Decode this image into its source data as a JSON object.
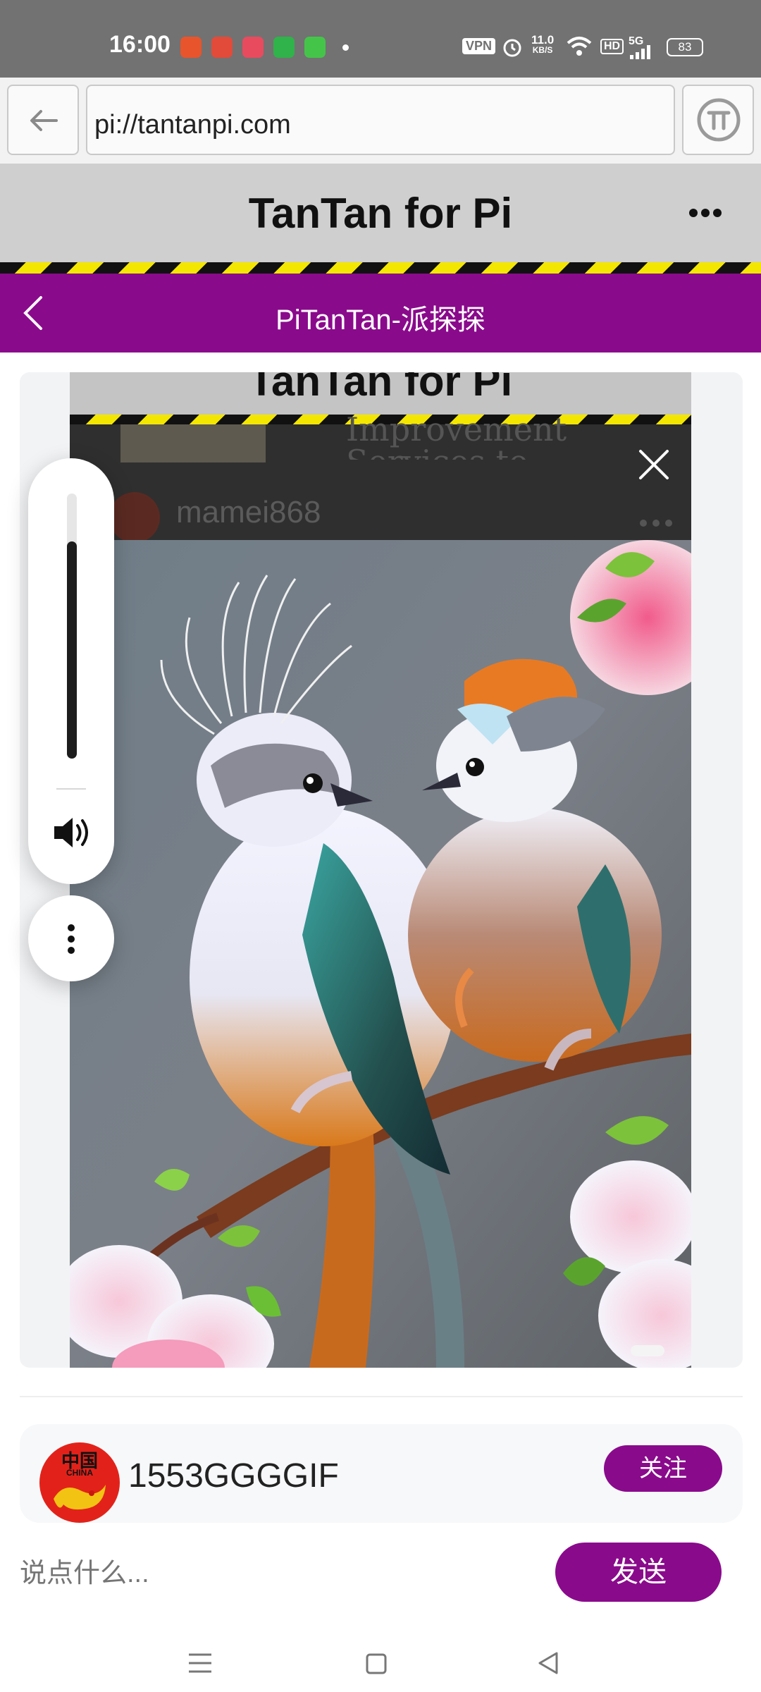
{
  "status_bar": {
    "time": "16:00",
    "vpn": "VPN",
    "net_speed_value": "11.0",
    "net_speed_unit": "KB/S",
    "hd": "HD",
    "network": "5G",
    "battery": "83",
    "app_icon_colors": [
      "#e8542c",
      "#e24b3a",
      "#e94b5e",
      "#2fb34a",
      "#45c44a"
    ]
  },
  "browser": {
    "url": "pi://tantanpi.com",
    "back_icon": "arrow-left-icon",
    "pi_icon": "pi-logo-icon"
  },
  "app_header": {
    "title": "TanTan for Pi",
    "menu_icon": "more-horizontal-icon"
  },
  "nav": {
    "title": "PiTanTan-派探探",
    "back_icon": "chevron-left-icon"
  },
  "viewer": {
    "bg_header_title": "TanTan for Pi",
    "bg_article_text_1": "Improvement",
    "bg_article_text_2": "Services to",
    "bg_username": "mamei868",
    "image_description": "two colorful crested birds on a branch with pink flowers",
    "volume_level_percent": 82
  },
  "author": {
    "name": "1553GGGGIF",
    "follow_label": "关注",
    "avatar_text": "中国",
    "avatar_subtext": "CHINA"
  },
  "comment": {
    "placeholder": "说点什么...",
    "send_label": "发送"
  },
  "colors": {
    "accent": "#8a0a8c",
    "hazard_yellow": "#f3e600",
    "header_gray": "#cfcfcf"
  }
}
